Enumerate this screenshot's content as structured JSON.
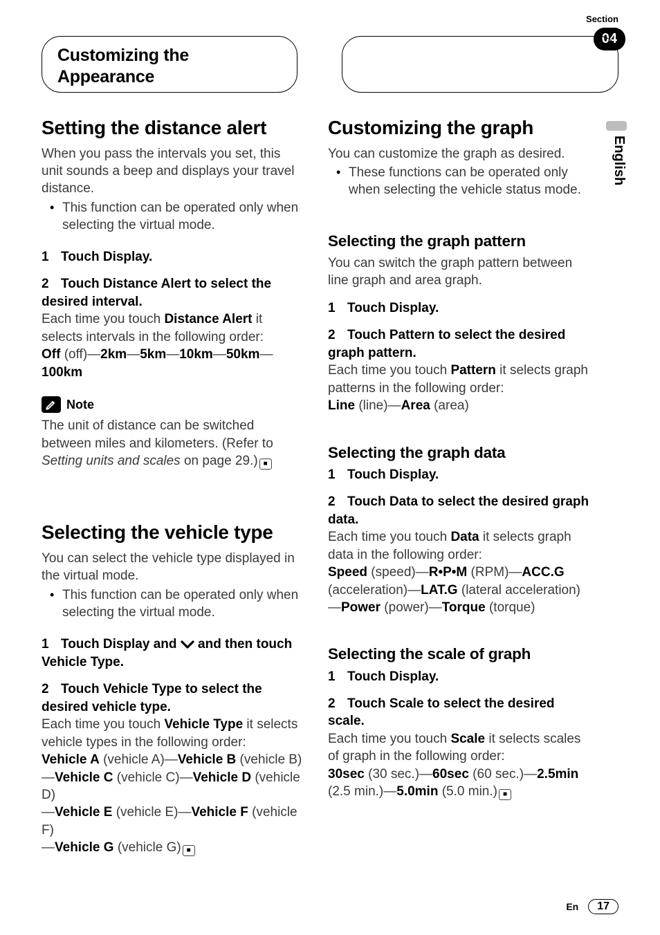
{
  "header": {
    "title": "Customizing the Appearance",
    "section_label": "Section",
    "section_number": "04",
    "language": "English"
  },
  "footer": {
    "lang_abbr": "En",
    "page_number": "17"
  },
  "left": {
    "h_distance": "Setting the distance alert",
    "distance_intro": "When you pass the intervals you set, this unit sounds a beep and displays your travel distance.",
    "distance_bullet": "This function can be operated only when selecting the virtual mode.",
    "step1_num": "1",
    "step1_text": "Touch Display.",
    "step2_num": "2",
    "step2_text": "Touch Distance Alert to select the desired interval.",
    "step2_body_a": "Each time you touch ",
    "step2_body_b": "Distance Alert",
    "step2_body_c": " it selects intervals in the following order:",
    "seq_off_b": "Off",
    "seq_off_p": " (off)—",
    "seq_2": "2km",
    "seq_5": "5km",
    "seq_10": "10km",
    "seq_50": "50km",
    "seq_100": "100km",
    "dash": "—",
    "note_label": "Note",
    "note_body_a": "The unit of distance can be switched between miles and kilometers. (Refer to ",
    "note_body_i": "Setting units and scales",
    "note_body_b": " on page 29.)",
    "h_vehicle": "Selecting the vehicle type",
    "veh_intro": "You can select the vehicle type displayed in the virtual mode.",
    "veh_bullet": "This function can be operated only when selecting the virtual mode.",
    "veh_step1_num": "1",
    "veh_step1_a": "Touch Display and ",
    "veh_step1_b": " and then touch Vehicle Type.",
    "veh_step2_num": "2",
    "veh_step2_text": "Touch Vehicle Type to select the desired vehicle type.",
    "veh_body_a": "Each time you touch ",
    "veh_body_b": "Vehicle Type",
    "veh_body_c": " it selects vehicle types in the following order:",
    "vA_b": "Vehicle A",
    "vA_p": " (vehicle A)—",
    "vB_b": "Vehicle B",
    "vB_p": " (vehicle B)",
    "vC_b": "Vehicle C",
    "vC_p": " (vehicle C)—",
    "vD_b": "Vehicle D",
    "vD_p": " (vehicle D)",
    "vE_b": "Vehicle E",
    "vE_p": " (vehicle E)—",
    "vF_b": "Vehicle F",
    "vF_p": " (vehicle F)",
    "vG_b": "Vehicle G",
    "vG_p": " (vehicle G)",
    "emdash": "—"
  },
  "right": {
    "h_graph": "Customizing the graph",
    "graph_intro": "You can customize the graph as desired.",
    "graph_bullet": "These functions can be operated only when selecting the vehicle status mode.",
    "h_pattern": "Selecting the graph pattern",
    "pattern_intro": "You can switch the graph pattern between line graph and area graph.",
    "p_step1_num": "1",
    "p_step1_text": "Touch Display.",
    "p_step2_num": "2",
    "p_step2_text": "Touch Pattern to select the desired graph pattern.",
    "p_body_a": "Each time you touch ",
    "p_body_b": "Pattern",
    "p_body_c": " it selects graph patterns in the following order:",
    "line_b": "Line",
    "line_p": " (line)—",
    "area_b": "Area",
    "area_p": " (area)",
    "h_data": "Selecting the graph data",
    "d_step1_num": "1",
    "d_step1_text": "Touch Display.",
    "d_step2_num": "2",
    "d_step2_text": "Touch Data to select the desired graph data.",
    "d_body_a": "Each time you touch ",
    "d_body_b": "Data",
    "d_body_c": " it selects graph data in the following order:",
    "speed_b": "Speed",
    "speed_p": " (speed)—",
    "rpm_b": "R•P•M",
    "rpm_p": " (RPM)—",
    "accg_b": "ACC.G",
    "accg_p": " (acceleration)—",
    "latg_b": "LAT.G",
    "latg_p": " (lateral acceleration)",
    "power_b": "Power",
    "power_p": " (power)—",
    "torque_b": "Torque",
    "torque_p": " (torque)",
    "emdash": "—",
    "h_scale": "Selecting the scale of graph",
    "s_step1_num": "1",
    "s_step1_text": "Touch Display.",
    "s_step2_num": "2",
    "s_step2_text": "Touch Scale to select the desired scale.",
    "s_body_a": "Each time you touch ",
    "s_body_b": "Scale",
    "s_body_c": " it selects scales of graph in the following order:",
    "s30_b": "30sec",
    "s30_p": " (30 sec.)—",
    "s60_b": "60sec",
    "s60_p": " (60 sec.)—",
    "s25_b": "2.5min",
    "s25_p": " (2.5 min.)—",
    "s50_b": "5.0min",
    "s50_p": " (5.0 min.)"
  }
}
